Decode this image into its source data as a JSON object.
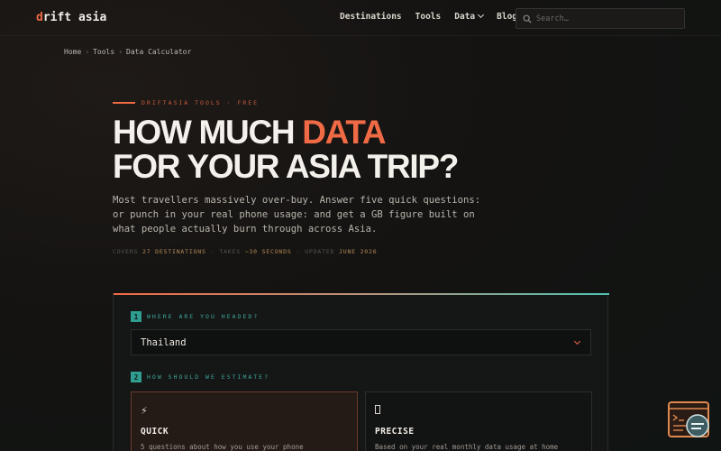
{
  "header": {
    "logo_first": "d",
    "logo_rest": "rift asia",
    "nav": [
      {
        "label": "Destinations"
      },
      {
        "label": "Tools"
      },
      {
        "label": "Data"
      },
      {
        "label": "Blog"
      }
    ],
    "search_placeholder": "Search…"
  },
  "breadcrumb": [
    "Home",
    "Tools",
    "Data Calculator"
  ],
  "hero": {
    "eyebrow": "DRIFTASIA TOOLS · FREE",
    "headline_pre": "HOW MUCH ",
    "headline_highlight": "DATA",
    "headline_line2": "FOR YOUR ASIA TRIP?",
    "lede": "Most travellers massively over-buy. Answer five quick questions: or punch in your real phone usage: and get a GB figure built on what people actually burn through across Asia.",
    "meta": {
      "covers_label": "COVERS",
      "covers_value": "27 DESTINATIONS",
      "takes_label": "TAKES",
      "takes_value": "~30 SECONDS",
      "updated_label": "UPDATED",
      "updated_value": "JUNE 2026"
    }
  },
  "form": {
    "step1": {
      "num": "1",
      "label": "WHERE ARE YOU HEADED?"
    },
    "destination": "Thailand",
    "step2": {
      "num": "2",
      "label": "HOW SHOULD WE ESTIMATE?"
    },
    "options": [
      {
        "glyph": "⚡",
        "title": "QUICK",
        "desc": "5 questions about how you use your phone"
      },
      {
        "glyph": "",
        "title": "PRECISE",
        "desc": "Based on your real monthly data usage at home"
      }
    ]
  },
  "colors": {
    "accent": "#ef6a45",
    "teal": "#2f9d8f",
    "background": "#141312"
  },
  "icons": {
    "search": "search-icon",
    "dropdown": "chevron-down-icon",
    "widget": "calculator-widget-icon"
  }
}
